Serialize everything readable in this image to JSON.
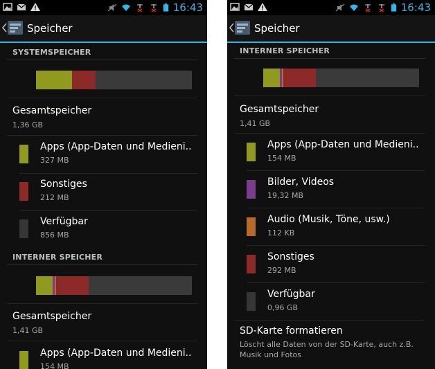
{
  "status": {
    "time": "16:43"
  },
  "left": {
    "title": "Speicher",
    "system_header": "SYSTEMSPEICHER",
    "system_usage": [
      {
        "label": "Apps (App-Daten und Medieni..",
        "fraction": 0.23,
        "color": "#8f9a1f"
      },
      {
        "label": "Sonstiges",
        "fraction": 0.15,
        "color": "#8c2a2a"
      },
      {
        "label": "Verfügbar",
        "fraction": 0.62,
        "color": "#3a3a3a"
      }
    ],
    "total_label": "Gesamtspeicher",
    "total_value": "1,36 GB",
    "items": [
      {
        "label": "Apps (App-Daten und Medieni..",
        "size": "327 MB",
        "color": "#8f9a1f"
      },
      {
        "label": "Sonstiges",
        "size": "212 MB",
        "color": "#8c2a2a"
      },
      {
        "label": "Verfügbar",
        "size": "856 MB",
        "color": "#363636"
      }
    ],
    "internal_header": "INTERNER SPEICHER",
    "internal_usage": [
      {
        "label": "Apps",
        "fraction": 0.105,
        "color": "#8f9a1f"
      },
      {
        "label": "Bilder, Videos",
        "fraction": 0.014,
        "color": "#7a3c8c"
      },
      {
        "label": "Audio",
        "fraction": 0.01,
        "color": "#b86a2a"
      },
      {
        "label": "Sonstiges",
        "fraction": 0.21,
        "color": "#8c2a2a"
      },
      {
        "label": "Verfügbar",
        "fraction": 0.661,
        "color": "#3a3a3a"
      }
    ],
    "internal_total_label": "Gesamtspeicher",
    "internal_total_value": "1,41 GB",
    "internal_first_item": {
      "label": "Apps (App-Daten und Medieni..",
      "size": "154 MB",
      "color": "#8f9a1f"
    }
  },
  "right": {
    "title": "Speicher",
    "internal_header": "INTERNER SPEICHER",
    "internal_usage": [
      {
        "label": "Apps",
        "fraction": 0.105,
        "color": "#8f9a1f"
      },
      {
        "label": "Bilder, Videos",
        "fraction": 0.014,
        "color": "#7a3c8c"
      },
      {
        "label": "Audio",
        "fraction": 0.01,
        "color": "#b86a2a"
      },
      {
        "label": "Sonstiges",
        "fraction": 0.21,
        "color": "#8c2a2a"
      },
      {
        "label": "Verfügbar",
        "fraction": 0.661,
        "color": "#3a3a3a"
      }
    ],
    "total_label": "Gesamtspeicher",
    "total_value": "1,41 GB",
    "items": [
      {
        "label": "Apps (App-Daten und Medieni..",
        "size": "154 MB",
        "color": "#8f9a1f"
      },
      {
        "label": "Bilder, Videos",
        "size": "19,32 MB",
        "color": "#7a3c8c"
      },
      {
        "label": "Audio (Musik, Töne, usw.)",
        "size": "112 KB",
        "color": "#b86a2a"
      },
      {
        "label": "Sonstiges",
        "size": "292 MB",
        "color": "#8c2a2a"
      },
      {
        "label": "Verfügbar",
        "size": "0,96 GB",
        "color": "#363636"
      }
    ],
    "sd_title": "SD-Karte formatieren",
    "sd_desc": "Löscht alle Daten von der SD-Karte, auch z.B. Musik und Fotos"
  },
  "accent": "#33b5e5",
  "icons": [
    "picture-icon",
    "mail-icon",
    "warning-icon",
    "mute-icon",
    "wifi-icon",
    "no-signal-icon",
    "battery-icon",
    "back-chevron-icon",
    "settings-app-icon"
  ]
}
